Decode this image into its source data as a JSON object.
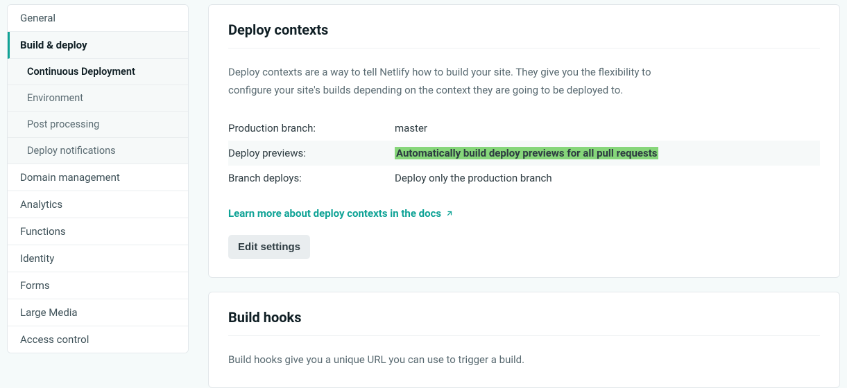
{
  "sidebar": {
    "items": [
      {
        "label": "General"
      },
      {
        "label": "Build & deploy"
      },
      {
        "label": "Domain management"
      },
      {
        "label": "Analytics"
      },
      {
        "label": "Functions"
      },
      {
        "label": "Identity"
      },
      {
        "label": "Forms"
      },
      {
        "label": "Large Media"
      },
      {
        "label": "Access control"
      }
    ],
    "sub": [
      {
        "label": "Continuous Deployment"
      },
      {
        "label": "Environment"
      },
      {
        "label": "Post processing"
      },
      {
        "label": "Deploy notifications"
      }
    ]
  },
  "deploy_contexts": {
    "title": "Deploy contexts",
    "description": "Deploy contexts are a way to tell Netlify how to build your site. They give you the flexibility to configure your site's builds depending on the context they are going to be deployed to.",
    "rows": [
      {
        "key": "Production branch:",
        "value": "master"
      },
      {
        "key": "Deploy previews:",
        "value": "Automatically build deploy previews for all pull requests"
      },
      {
        "key": "Branch deploys:",
        "value": "Deploy only the production branch"
      }
    ],
    "learn_more": "Learn more about deploy contexts in the docs",
    "edit_button": "Edit settings"
  },
  "build_hooks": {
    "title": "Build hooks",
    "description": "Build hooks give you a unique URL you can use to trigger a build."
  }
}
